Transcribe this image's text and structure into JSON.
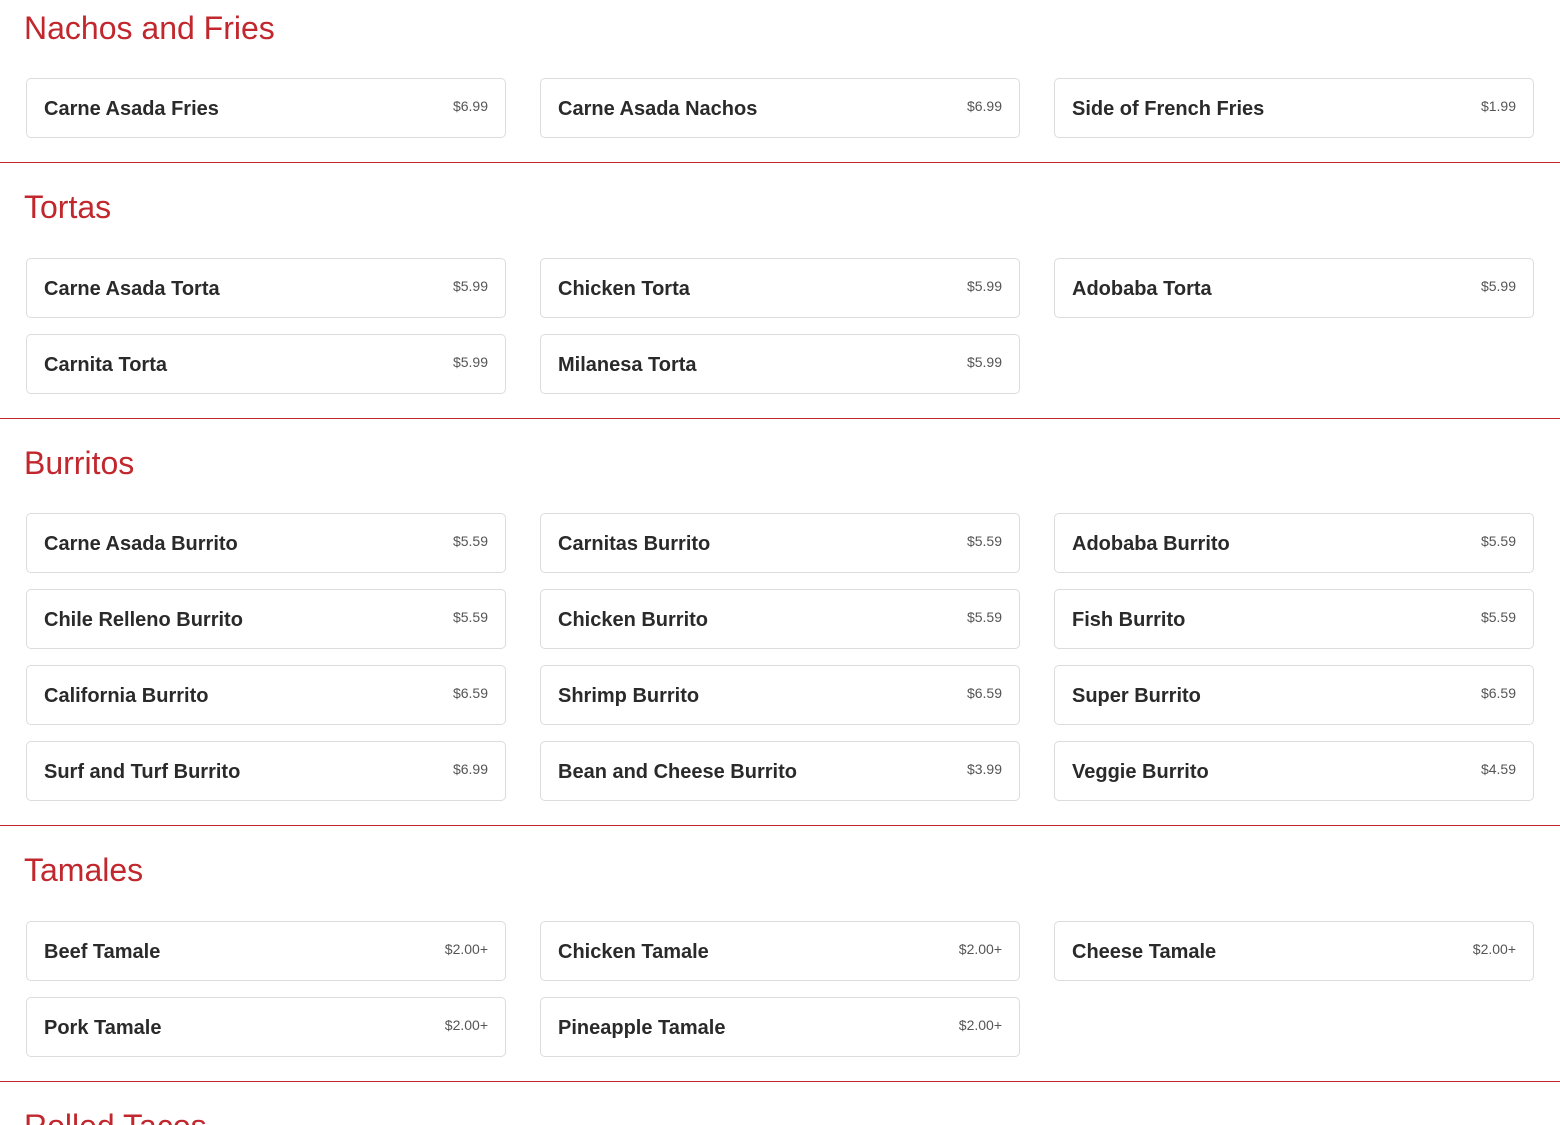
{
  "accent_color": "#c1272d",
  "sections": [
    {
      "title": "Nachos and Fries",
      "items": [
        {
          "name": "Carne Asada Fries",
          "price": "$6.99"
        },
        {
          "name": "Carne Asada Nachos",
          "price": "$6.99"
        },
        {
          "name": "Side of French Fries",
          "price": "$1.99"
        }
      ]
    },
    {
      "title": "Tortas",
      "items": [
        {
          "name": "Carne Asada Torta",
          "price": "$5.99"
        },
        {
          "name": "Chicken Torta",
          "price": "$5.99"
        },
        {
          "name": "Adobaba Torta",
          "price": "$5.99"
        },
        {
          "name": "Carnita Torta",
          "price": "$5.99"
        },
        {
          "name": "Milanesa Torta",
          "price": "$5.99"
        }
      ]
    },
    {
      "title": "Burritos",
      "items": [
        {
          "name": "Carne Asada Burrito",
          "price": "$5.59"
        },
        {
          "name": "Carnitas Burrito",
          "price": "$5.59"
        },
        {
          "name": "Adobaba Burrito",
          "price": "$5.59"
        },
        {
          "name": "Chile Relleno Burrito",
          "price": "$5.59"
        },
        {
          "name": "Chicken Burrito",
          "price": "$5.59"
        },
        {
          "name": "Fish Burrito",
          "price": "$5.59"
        },
        {
          "name": "California Burrito",
          "price": "$6.59"
        },
        {
          "name": "Shrimp Burrito",
          "price": "$6.59"
        },
        {
          "name": "Super Burrito",
          "price": "$6.59"
        },
        {
          "name": "Surf and Turf Burrito",
          "price": "$6.99"
        },
        {
          "name": "Bean and Cheese Burrito",
          "price": "$3.99"
        },
        {
          "name": "Veggie Burrito",
          "price": "$4.59"
        }
      ]
    },
    {
      "title": "Tamales",
      "items": [
        {
          "name": "Beef Tamale",
          "price": "$2.00+"
        },
        {
          "name": "Chicken Tamale",
          "price": "$2.00+"
        },
        {
          "name": "Cheese Tamale",
          "price": "$2.00+"
        },
        {
          "name": "Pork Tamale",
          "price": "$2.00+"
        },
        {
          "name": "Pineapple Tamale",
          "price": "$2.00+"
        }
      ]
    },
    {
      "title": "Rolled Tacos",
      "items": []
    }
  ]
}
